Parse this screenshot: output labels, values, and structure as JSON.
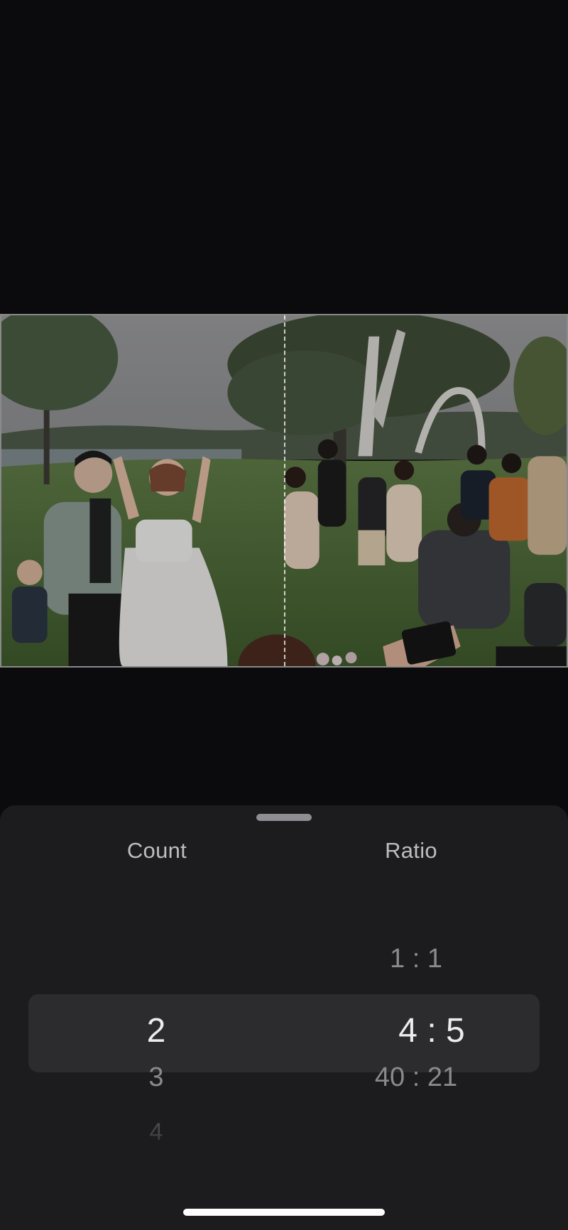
{
  "photo": {
    "description_icon": "photo-preview",
    "split_count": 2
  },
  "picker": {
    "count": {
      "title": "Count",
      "options_before": [],
      "selected": "2",
      "options_after": [
        "3",
        "4"
      ]
    },
    "ratio": {
      "title": "Ratio",
      "options_before": [
        "1 : 1"
      ],
      "selected": "4 : 5",
      "options_after": [
        "40 : 21"
      ]
    }
  },
  "colors": {
    "sheet_background": "#1c1c1e",
    "selection_band": "#2c2c2f",
    "page_background": "#0b0a0c"
  }
}
